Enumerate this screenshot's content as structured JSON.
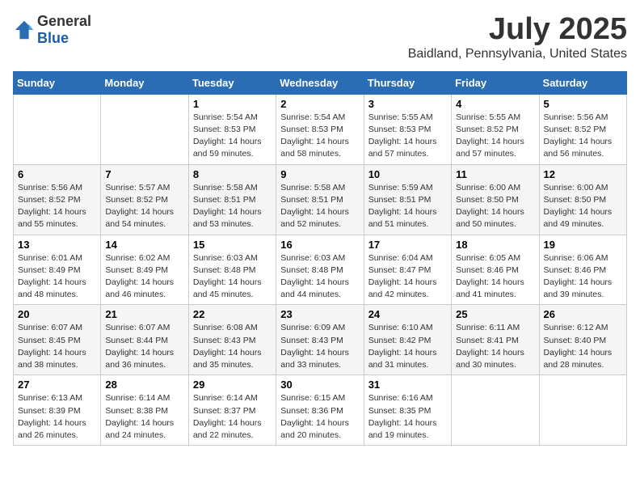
{
  "header": {
    "logo_general": "General",
    "logo_blue": "Blue",
    "title": "July 2025",
    "subtitle": "Baidland, Pennsylvania, United States"
  },
  "calendar": {
    "days_of_week": [
      "Sunday",
      "Monday",
      "Tuesday",
      "Wednesday",
      "Thursday",
      "Friday",
      "Saturday"
    ],
    "weeks": [
      [
        {
          "day": "",
          "info": ""
        },
        {
          "day": "",
          "info": ""
        },
        {
          "day": "1",
          "info": "Sunrise: 5:54 AM\nSunset: 8:53 PM\nDaylight: 14 hours\nand 59 minutes."
        },
        {
          "day": "2",
          "info": "Sunrise: 5:54 AM\nSunset: 8:53 PM\nDaylight: 14 hours\nand 58 minutes."
        },
        {
          "day": "3",
          "info": "Sunrise: 5:55 AM\nSunset: 8:53 PM\nDaylight: 14 hours\nand 57 minutes."
        },
        {
          "day": "4",
          "info": "Sunrise: 5:55 AM\nSunset: 8:52 PM\nDaylight: 14 hours\nand 57 minutes."
        },
        {
          "day": "5",
          "info": "Sunrise: 5:56 AM\nSunset: 8:52 PM\nDaylight: 14 hours\nand 56 minutes."
        }
      ],
      [
        {
          "day": "6",
          "info": "Sunrise: 5:56 AM\nSunset: 8:52 PM\nDaylight: 14 hours\nand 55 minutes."
        },
        {
          "day": "7",
          "info": "Sunrise: 5:57 AM\nSunset: 8:52 PM\nDaylight: 14 hours\nand 54 minutes."
        },
        {
          "day": "8",
          "info": "Sunrise: 5:58 AM\nSunset: 8:51 PM\nDaylight: 14 hours\nand 53 minutes."
        },
        {
          "day": "9",
          "info": "Sunrise: 5:58 AM\nSunset: 8:51 PM\nDaylight: 14 hours\nand 52 minutes."
        },
        {
          "day": "10",
          "info": "Sunrise: 5:59 AM\nSunset: 8:51 PM\nDaylight: 14 hours\nand 51 minutes."
        },
        {
          "day": "11",
          "info": "Sunrise: 6:00 AM\nSunset: 8:50 PM\nDaylight: 14 hours\nand 50 minutes."
        },
        {
          "day": "12",
          "info": "Sunrise: 6:00 AM\nSunset: 8:50 PM\nDaylight: 14 hours\nand 49 minutes."
        }
      ],
      [
        {
          "day": "13",
          "info": "Sunrise: 6:01 AM\nSunset: 8:49 PM\nDaylight: 14 hours\nand 48 minutes."
        },
        {
          "day": "14",
          "info": "Sunrise: 6:02 AM\nSunset: 8:49 PM\nDaylight: 14 hours\nand 46 minutes."
        },
        {
          "day": "15",
          "info": "Sunrise: 6:03 AM\nSunset: 8:48 PM\nDaylight: 14 hours\nand 45 minutes."
        },
        {
          "day": "16",
          "info": "Sunrise: 6:03 AM\nSunset: 8:48 PM\nDaylight: 14 hours\nand 44 minutes."
        },
        {
          "day": "17",
          "info": "Sunrise: 6:04 AM\nSunset: 8:47 PM\nDaylight: 14 hours\nand 42 minutes."
        },
        {
          "day": "18",
          "info": "Sunrise: 6:05 AM\nSunset: 8:46 PM\nDaylight: 14 hours\nand 41 minutes."
        },
        {
          "day": "19",
          "info": "Sunrise: 6:06 AM\nSunset: 8:46 PM\nDaylight: 14 hours\nand 39 minutes."
        }
      ],
      [
        {
          "day": "20",
          "info": "Sunrise: 6:07 AM\nSunset: 8:45 PM\nDaylight: 14 hours\nand 38 minutes."
        },
        {
          "day": "21",
          "info": "Sunrise: 6:07 AM\nSunset: 8:44 PM\nDaylight: 14 hours\nand 36 minutes."
        },
        {
          "day": "22",
          "info": "Sunrise: 6:08 AM\nSunset: 8:43 PM\nDaylight: 14 hours\nand 35 minutes."
        },
        {
          "day": "23",
          "info": "Sunrise: 6:09 AM\nSunset: 8:43 PM\nDaylight: 14 hours\nand 33 minutes."
        },
        {
          "day": "24",
          "info": "Sunrise: 6:10 AM\nSunset: 8:42 PM\nDaylight: 14 hours\nand 31 minutes."
        },
        {
          "day": "25",
          "info": "Sunrise: 6:11 AM\nSunset: 8:41 PM\nDaylight: 14 hours\nand 30 minutes."
        },
        {
          "day": "26",
          "info": "Sunrise: 6:12 AM\nSunset: 8:40 PM\nDaylight: 14 hours\nand 28 minutes."
        }
      ],
      [
        {
          "day": "27",
          "info": "Sunrise: 6:13 AM\nSunset: 8:39 PM\nDaylight: 14 hours\nand 26 minutes."
        },
        {
          "day": "28",
          "info": "Sunrise: 6:14 AM\nSunset: 8:38 PM\nDaylight: 14 hours\nand 24 minutes."
        },
        {
          "day": "29",
          "info": "Sunrise: 6:14 AM\nSunset: 8:37 PM\nDaylight: 14 hours\nand 22 minutes."
        },
        {
          "day": "30",
          "info": "Sunrise: 6:15 AM\nSunset: 8:36 PM\nDaylight: 14 hours\nand 20 minutes."
        },
        {
          "day": "31",
          "info": "Sunrise: 6:16 AM\nSunset: 8:35 PM\nDaylight: 14 hours\nand 19 minutes."
        },
        {
          "day": "",
          "info": ""
        },
        {
          "day": "",
          "info": ""
        }
      ]
    ]
  }
}
